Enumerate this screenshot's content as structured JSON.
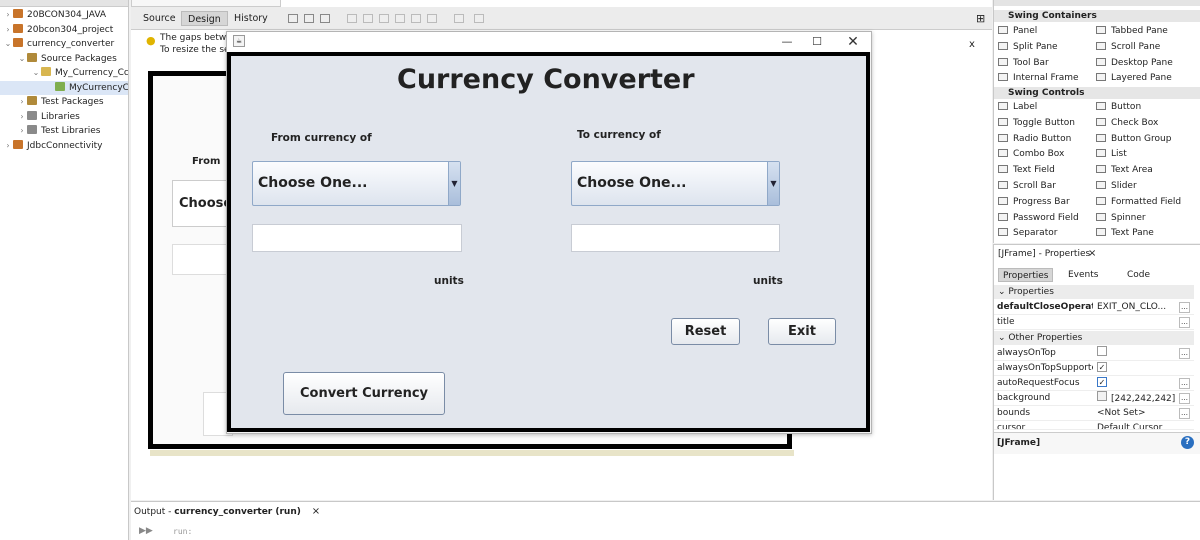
{
  "project_tree": [
    {
      "label": "20BCON304_JAVA",
      "indent": 0,
      "toggle": "›",
      "icon_color": "#c8742a"
    },
    {
      "label": "20bcon304_project",
      "indent": 0,
      "toggle": "›",
      "icon_color": "#c8742a"
    },
    {
      "label": "currency_converter",
      "indent": 0,
      "toggle": "⌄",
      "icon_color": "#c8742a"
    },
    {
      "label": "Source Packages",
      "indent": 1,
      "toggle": "⌄",
      "icon_color": "#b08a3a"
    },
    {
      "label": "My_Currency_Cc",
      "indent": 2,
      "toggle": "⌄",
      "icon_color": "#d8b650"
    },
    {
      "label": "MyCurrencyC",
      "indent": 3,
      "toggle": "",
      "icon_color": "#7fae4e",
      "selected": true
    },
    {
      "label": "Test Packages",
      "indent": 1,
      "toggle": "›",
      "icon_color": "#b08a3a"
    },
    {
      "label": "Libraries",
      "indent": 1,
      "toggle": "›",
      "icon_color": "#8a8a8a"
    },
    {
      "label": "Test Libraries",
      "indent": 1,
      "toggle": "›",
      "icon_color": "#8a8a8a"
    },
    {
      "label": "JdbcConnectivity",
      "indent": 0,
      "toggle": "›",
      "icon_color": "#c8742a"
    }
  ],
  "editor": {
    "tabs": {
      "source": "Source",
      "design": "Design",
      "history": "History"
    },
    "hint": {
      "line1": "The gaps betwe",
      "line2": "To resize the se",
      "close": "x"
    },
    "design_preview": {
      "from_label": "From",
      "choose_label": "Choose"
    }
  },
  "app": {
    "title": "Currency Converter",
    "from_label": "From currency of",
    "to_label": "To currency of",
    "from_combo": "Choose One...",
    "to_combo": "Choose One...",
    "from_value": "",
    "to_value": "",
    "from_units": "units",
    "to_units": "units",
    "reset": "Reset",
    "exit": "Exit",
    "convert": "Convert Currency"
  },
  "palette": {
    "containers_title": "Swing Containers",
    "containers": [
      "Panel",
      "Tabbed Pane",
      "Split Pane",
      "Scroll Pane",
      "Tool Bar",
      "Desktop Pane",
      "Internal Frame",
      "Layered Pane"
    ],
    "controls_title": "Swing Controls",
    "controls": [
      "Label",
      "Button",
      "Toggle Button",
      "Check Box",
      "Radio Button",
      "Button Group",
      "Combo Box",
      "List",
      "Text Field",
      "Text Area",
      "Scroll Bar",
      "Slider",
      "Progress Bar",
      "Formatted Field",
      "Password Field",
      "Spinner",
      "Separator",
      "Text Pane"
    ]
  },
  "properties": {
    "title": "[JFrame] - Properties",
    "close": "×",
    "tabs": {
      "properties": "Properties",
      "events": "Events",
      "code": "Code"
    },
    "cat_properties": "Properties",
    "cat_other": "Other Properties",
    "rows": {
      "close_op": {
        "name": "defaultCloseOperatior",
        "value": "EXIT_ON_CLO..."
      },
      "title": {
        "name": "title",
        "value": ""
      },
      "always_on_top": {
        "name": "alwaysOnTop",
        "value": ""
      },
      "always_on_top_supported": {
        "name": "alwaysOnTopSupportec",
        "value": "✓"
      },
      "auto_request_focus": {
        "name": "autoRequestFocus",
        "value": "✓"
      },
      "background": {
        "name": "background",
        "value": "[242,242,242]"
      },
      "bounds": {
        "name": "bounds",
        "value": "<Not Set>"
      },
      "cursor": {
        "name": "cursor",
        "value": "Default Cursor"
      }
    },
    "footer": "[JFrame]"
  },
  "output": {
    "prefix": "Output - ",
    "project": "currency_converter (run)",
    "close": "×",
    "console": "run:"
  }
}
